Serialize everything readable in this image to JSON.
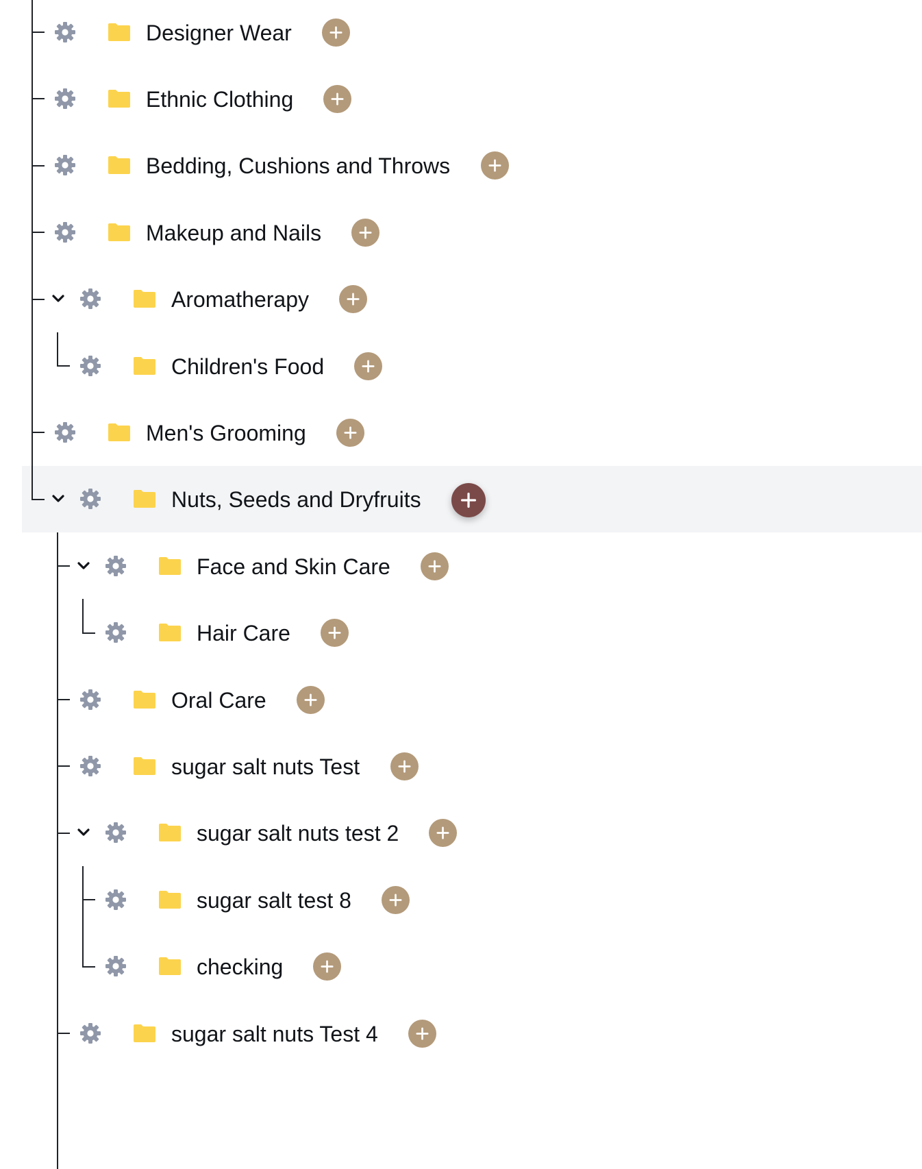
{
  "colors": {
    "connector": "#1f2328",
    "gear": "#8f97a8",
    "folder": "#fcd34d",
    "add_button": "#b39a7a",
    "add_button_active": "#7a4a48",
    "row_highlight": "#f3f4f6",
    "text": "#111418"
  },
  "icons": {
    "settings": "gear-icon",
    "category": "folder-icon",
    "add": "plus-icon",
    "expand": "chevron-down-icon"
  },
  "tree": {
    "items": [
      {
        "id": "designer-wear",
        "label": "Designer Wear",
        "depth": 0,
        "expanded": false,
        "selected": false
      },
      {
        "id": "ethnic-clothing",
        "label": "Ethnic Clothing",
        "depth": 0,
        "expanded": false,
        "selected": false
      },
      {
        "id": "bedding",
        "label": "Bedding, Cushions and Throws",
        "depth": 0,
        "expanded": false,
        "selected": false
      },
      {
        "id": "makeup-nails",
        "label": "Makeup and Nails",
        "depth": 0,
        "expanded": false,
        "selected": false
      },
      {
        "id": "aromatherapy",
        "label": "Aromatherapy",
        "depth": 0,
        "expanded": true,
        "selected": false
      },
      {
        "id": "childrens-food",
        "label": "Children's Food",
        "depth": 1,
        "expanded": false,
        "selected": false
      },
      {
        "id": "mens-grooming",
        "label": "Men's Grooming",
        "depth": 0,
        "expanded": false,
        "selected": false
      },
      {
        "id": "nuts-seeds",
        "label": "Nuts, Seeds and Dryfruits",
        "depth": 0,
        "expanded": true,
        "selected": true
      },
      {
        "id": "face-skin",
        "label": "Face and Skin Care",
        "depth": 1,
        "expanded": true,
        "selected": false
      },
      {
        "id": "hair-care",
        "label": "Hair Care",
        "depth": 2,
        "expanded": false,
        "selected": false
      },
      {
        "id": "oral-care",
        "label": "Oral Care",
        "depth": 1,
        "expanded": false,
        "selected": false
      },
      {
        "id": "sugar-salt-nuts-test",
        "label": "sugar salt nuts Test",
        "depth": 1,
        "expanded": false,
        "selected": false
      },
      {
        "id": "sugar-salt-nuts-test-2",
        "label": "sugar salt nuts test 2",
        "depth": 1,
        "expanded": true,
        "selected": false
      },
      {
        "id": "sugar-salt-test-8",
        "label": "sugar salt test 8",
        "depth": 2,
        "expanded": false,
        "selected": false
      },
      {
        "id": "checking",
        "label": "checking",
        "depth": 2,
        "expanded": false,
        "selected": false
      },
      {
        "id": "sugar-salt-nuts-test-4",
        "label": "sugar salt nuts Test 4",
        "depth": 1,
        "expanded": false,
        "selected": false
      }
    ]
  }
}
